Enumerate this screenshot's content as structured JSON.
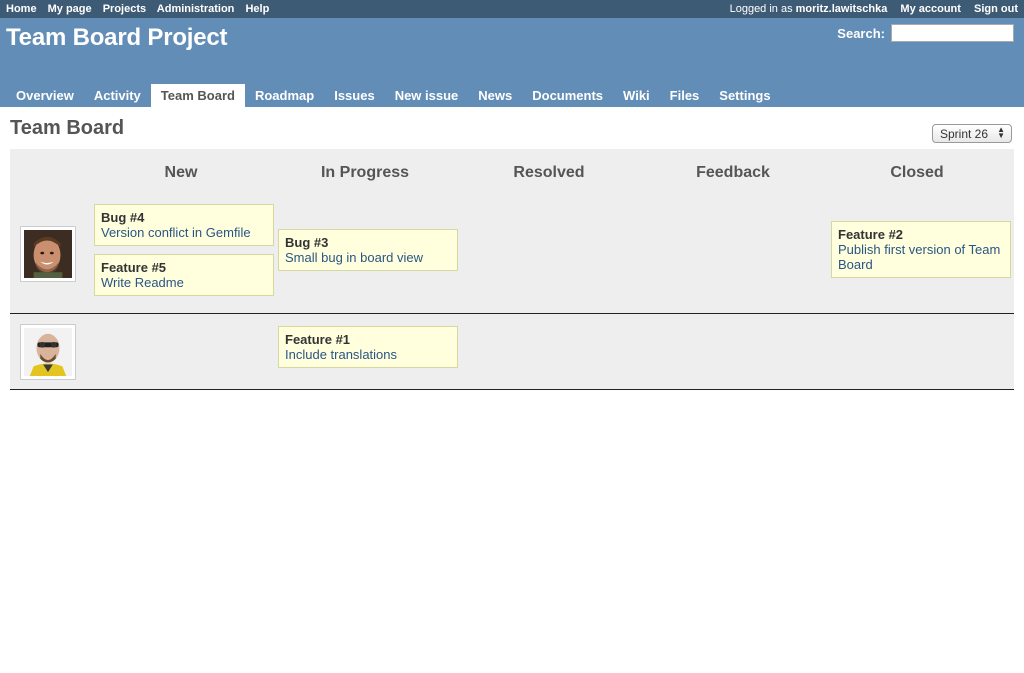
{
  "top_menu": {
    "left": [
      "Home",
      "My page",
      "Projects",
      "Administration",
      "Help"
    ],
    "logged_prefix": "Logged in as ",
    "user": "moritz.lawitschka",
    "my_account": "My account",
    "sign_out": "Sign out"
  },
  "header": {
    "title": "Team Board Project",
    "search_label": "Search:",
    "search_value": ""
  },
  "main_menu": [
    "Overview",
    "Activity",
    "Team Board",
    "Roadmap",
    "Issues",
    "New issue",
    "News",
    "Documents",
    "Wiki",
    "Files",
    "Settings"
  ],
  "main_menu_selected": "Team Board",
  "page": {
    "title": "Team Board",
    "sprint": "Sprint 26"
  },
  "board": {
    "columns": [
      "New",
      "In Progress",
      "Resolved",
      "Feedback",
      "Closed"
    ],
    "lanes": [
      {
        "avatar": "user-avatar-smiling",
        "cards": [
          {
            "title": "Bug #4",
            "desc": "Version conflict in Gemfile",
            "column": "New"
          },
          {
            "title": "Feature #5",
            "desc": "Write Readme",
            "column": "New"
          },
          {
            "title": "Bug #3",
            "desc": "Small bug in board view",
            "column": "In Progress"
          },
          {
            "title": "Feature #2",
            "desc": "Publish first version of Team Board",
            "column": "Closed"
          }
        ]
      },
      {
        "avatar": "user-avatar-bald-goatee",
        "cards": [
          {
            "title": "Feature #1",
            "desc": "Include translations",
            "column": "In Progress"
          }
        ]
      }
    ]
  }
}
